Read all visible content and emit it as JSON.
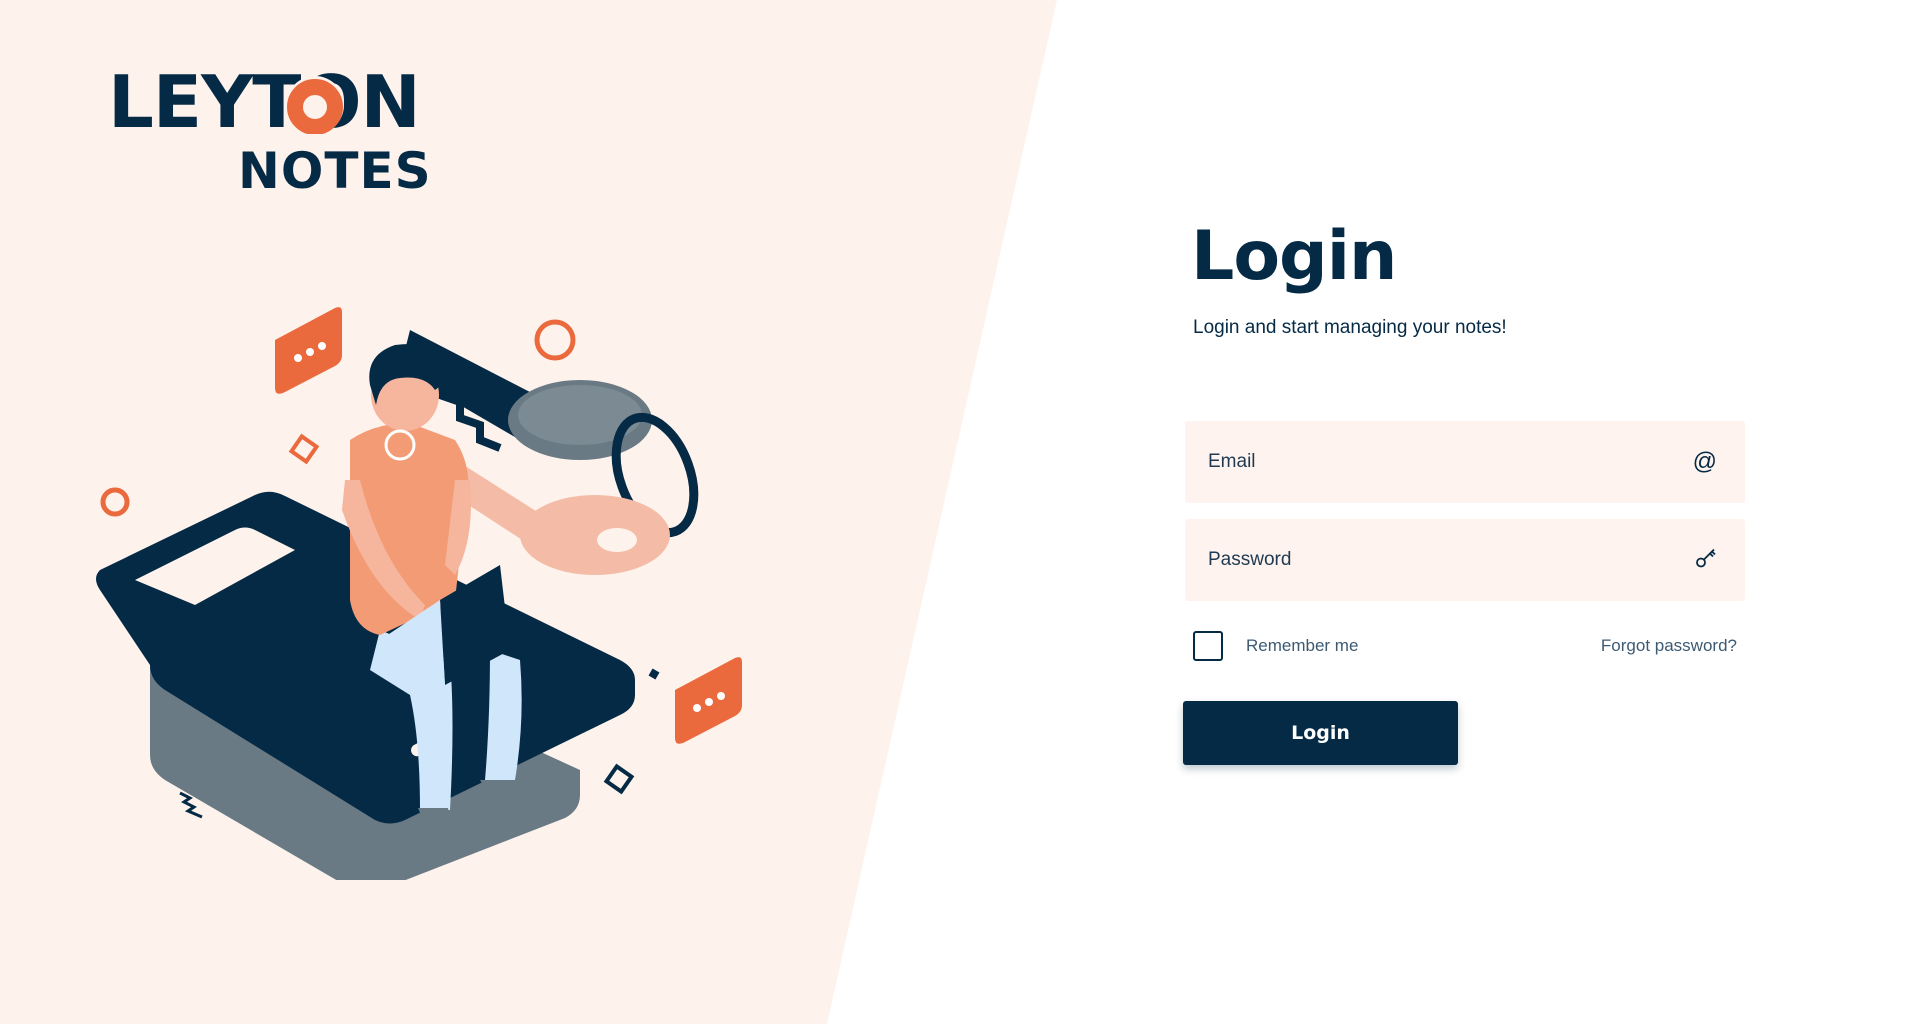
{
  "brand": {
    "logo_top": "LEYTON",
    "logo_bottom": "NOTES"
  },
  "login": {
    "title": "Login",
    "subtitle": "Login and start managing your notes!",
    "email_placeholder": "Email",
    "email_icon": "at-sign-icon",
    "email_icon_glyph": "@",
    "password_placeholder": "Password",
    "password_icon": "key-icon",
    "remember_label": "Remember me",
    "remember_checked": false,
    "forgot_label": "Forgot password?",
    "button_label": "Login"
  },
  "colors": {
    "navy": "#052a45",
    "accent": "#ea6a3d",
    "panel": "#fef2ec",
    "field": "#fef3ee"
  }
}
